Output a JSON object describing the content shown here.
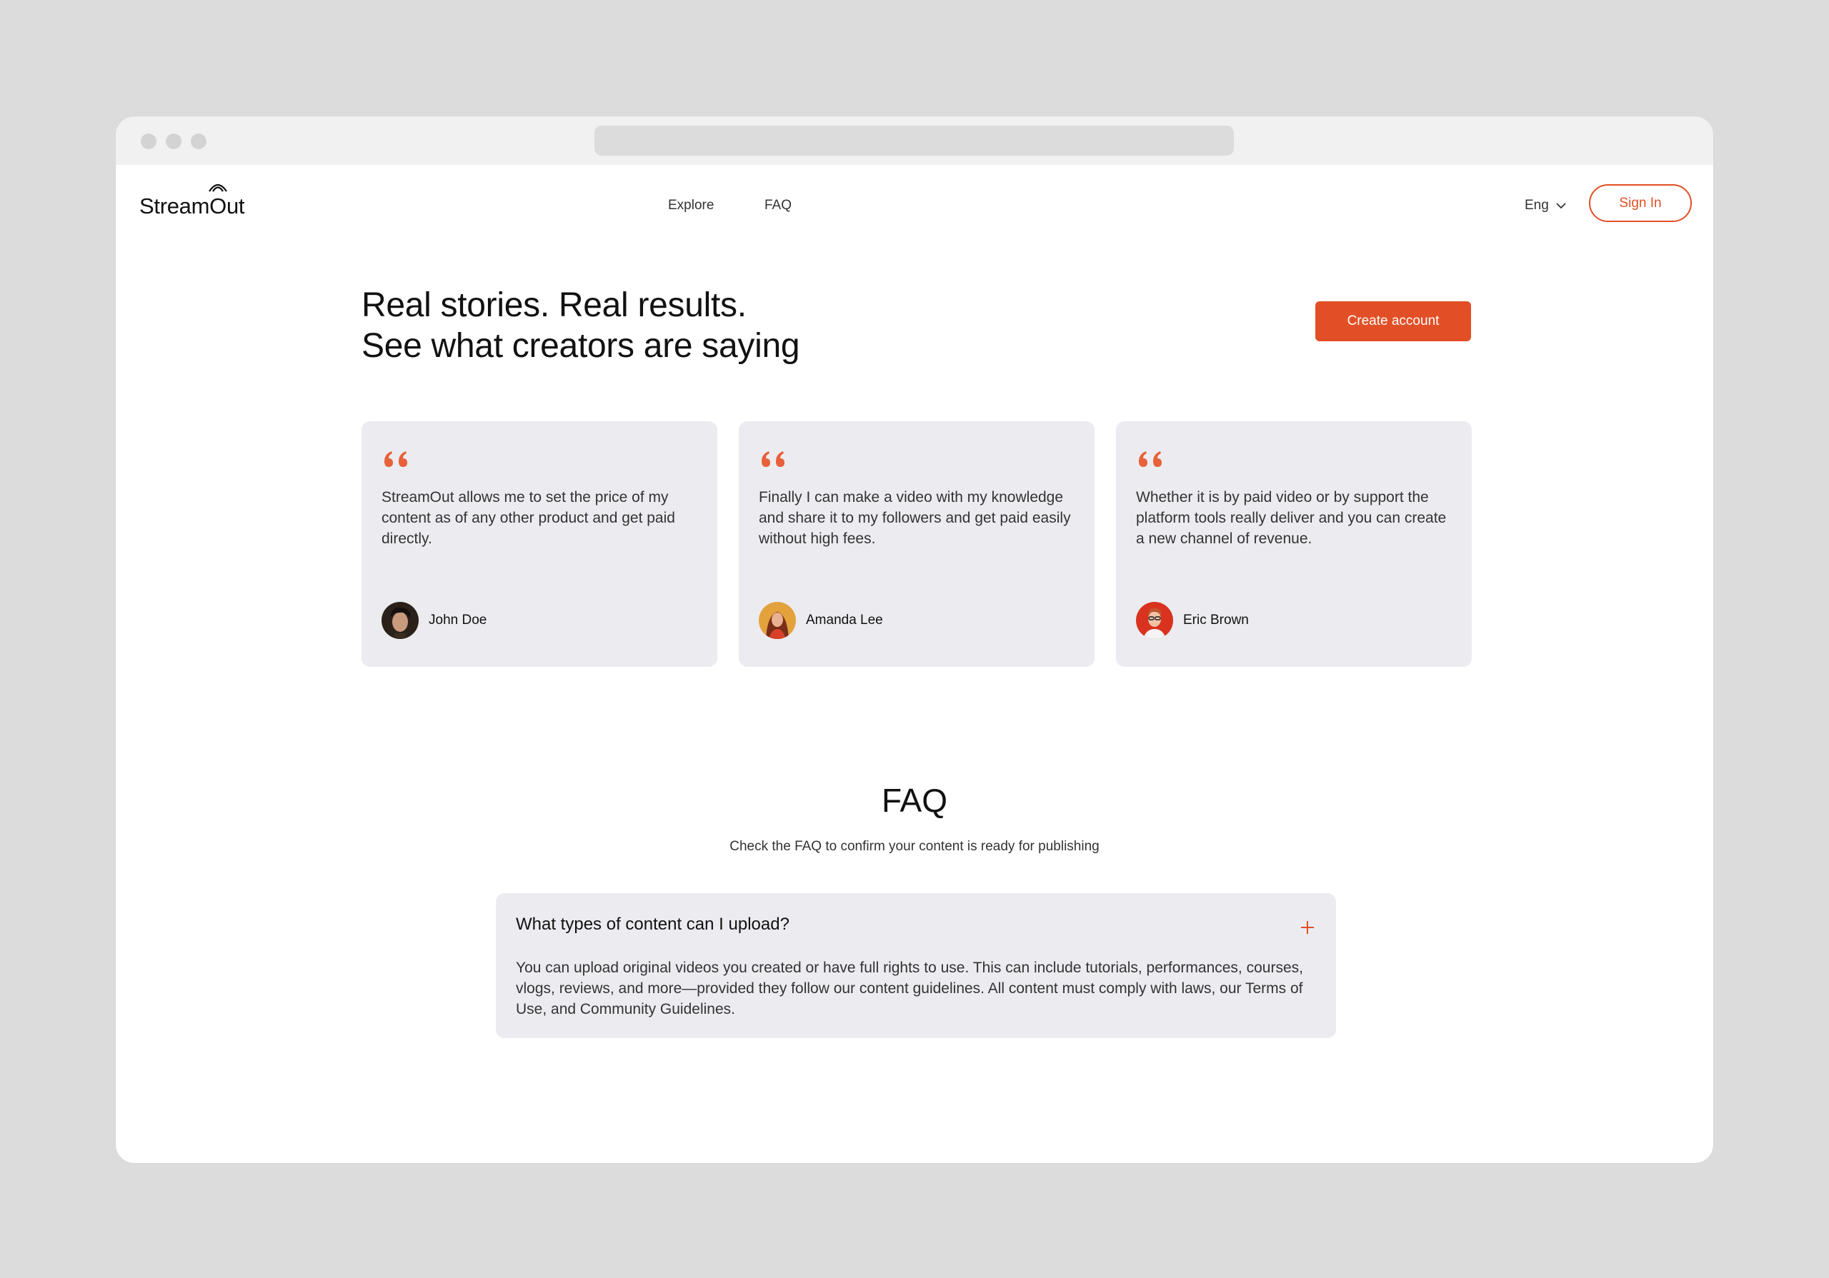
{
  "brand": {
    "name_prefix": "Stream",
    "name_o": "O",
    "name_suffix": "ut",
    "accent": "#e24f26"
  },
  "nav": {
    "links": [
      "Explore",
      "FAQ"
    ],
    "language": "Eng",
    "sign_in": "Sign In"
  },
  "hero": {
    "title_line1": "Real stories. Real results.",
    "title_line2": "See what creators are saying",
    "cta": "Create account"
  },
  "testimonials": [
    {
      "text": "StreamOut allows me to set the price of my content as of any other product and get paid directly.",
      "author": "John Doe"
    },
    {
      "text": "Finally I can make a video with my knowledge and share it to my followers and get paid easily without high fees.",
      "author": "Amanda Lee"
    },
    {
      "text": "Whether it is by paid video or by support the platform tools really deliver and you can create a new channel of revenue.",
      "author": "Eric Brown"
    }
  ],
  "faq": {
    "title": "FAQ",
    "subtitle": "Check the FAQ to confirm your content is ready for publishing",
    "items": [
      {
        "question": "What types of content can I upload?",
        "answer": "You can upload original videos you created or have full rights to use. This can include tutorials, performances, courses, vlogs, reviews, and more—provided they follow our content guidelines. All content must comply with laws, our Terms of Use, and Community Guidelines."
      }
    ]
  }
}
